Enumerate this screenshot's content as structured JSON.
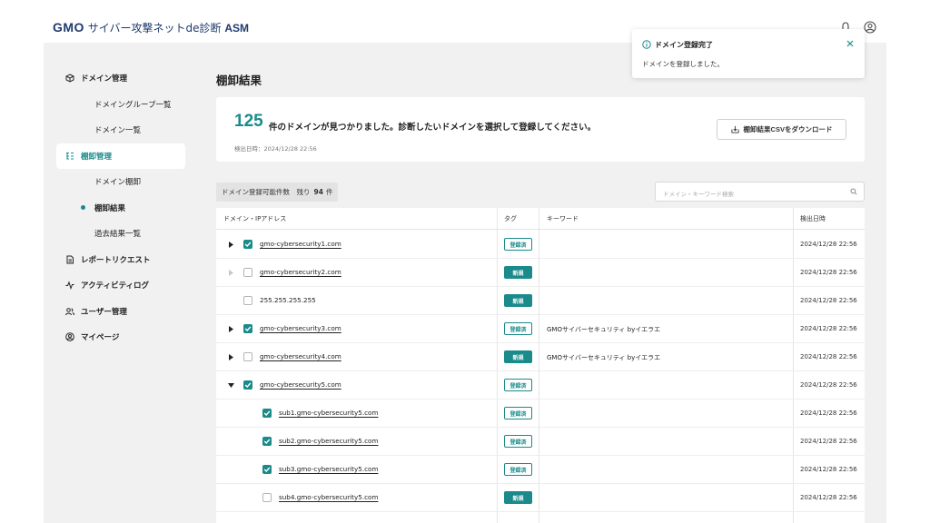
{
  "header": {
    "logo_gmo": "GMO",
    "logo_text": "サイバー攻撃ネットde診断",
    "logo_asm": "ASM"
  },
  "sidebar": {
    "items": [
      {
        "label": "ドメイン管理",
        "icon": "cube-icon"
      },
      {
        "label": "ドメイングループ一覧"
      },
      {
        "label": "ドメイン一覧"
      },
      {
        "label": "棚卸管理",
        "icon": "tree-icon"
      },
      {
        "label": "ドメイン棚卸"
      },
      {
        "label": "棚卸結果"
      },
      {
        "label": "過去結果一覧"
      },
      {
        "label": "レポートリクエスト",
        "icon": "document-icon"
      },
      {
        "label": "アクティビティログ",
        "icon": "pulse-icon"
      },
      {
        "label": "ユーザー管理",
        "icon": "users-icon"
      },
      {
        "label": "マイページ",
        "icon": "user-circle-icon"
      }
    ]
  },
  "page": {
    "title": "棚卸結果"
  },
  "summary": {
    "count": "125",
    "message": "件のドメインが見つかりました。診断したいドメインを選択して登録してください。",
    "detected": "検出日時：2024/12/28 22:56",
    "download_label": "棚卸結果CSVをダウンロード"
  },
  "remaining": {
    "label": "ドメイン登録可能件数　残り",
    "value": "94",
    "unit": "件"
  },
  "search": {
    "placeholder": "ドメイン・キーワード検索"
  },
  "table": {
    "headers": {
      "domain": "ドメイン・IPアドレス",
      "tag": "タグ",
      "keyword": "キーワード",
      "date": "検出日時"
    },
    "rows": [
      {
        "domain": "gmo-cybersecurity1.com",
        "tag": "登録済",
        "keyword": "",
        "date": "2024/12/28 22:56"
      },
      {
        "domain": "gmo-cybersecurity2.com",
        "tag": "新規",
        "keyword": "",
        "date": "2024/12/28 22:56"
      },
      {
        "domain": "255.255.255.255",
        "tag": "新規",
        "keyword": "",
        "date": "2024/12/28 22:56"
      },
      {
        "domain": "gmo-cybersecurity3.com",
        "tag": "登録済",
        "keyword": "GMOサイバーセキュリティ byイエラエ",
        "date": "2024/12/28 22:56"
      },
      {
        "domain": "gmo-cybersecurity4.com",
        "tag": "新規",
        "keyword": "GMOサイバーセキュリティ byイエラエ",
        "date": "2024/12/28 22:56"
      },
      {
        "domain": "gmo-cybersecurity5.com",
        "tag": "登録済",
        "keyword": "",
        "date": "2024/12/28 22:56"
      },
      {
        "domain": "sub1.gmo-cybersecurity5.com",
        "tag": "登録済",
        "keyword": "",
        "date": "2024/12/28 22:56"
      },
      {
        "domain": "sub2.gmo-cybersecurity5.com",
        "tag": "登録済",
        "keyword": "",
        "date": "2024/12/28 22:56"
      },
      {
        "domain": "sub3.gmo-cybersecurity5.com",
        "tag": "登録済",
        "keyword": "",
        "date": "2024/12/28 22:56"
      },
      {
        "domain": "sub4.gmo-cybersecurity5.com",
        "tag": "新規",
        "keyword": "",
        "date": "2024/12/28 22:56"
      }
    ]
  },
  "toast": {
    "title": "ドメイン登録完了",
    "message": "ドメインを登録しました。"
  },
  "colors": {
    "accent": "#1a8a8a",
    "logo": "#1f3a6e"
  }
}
